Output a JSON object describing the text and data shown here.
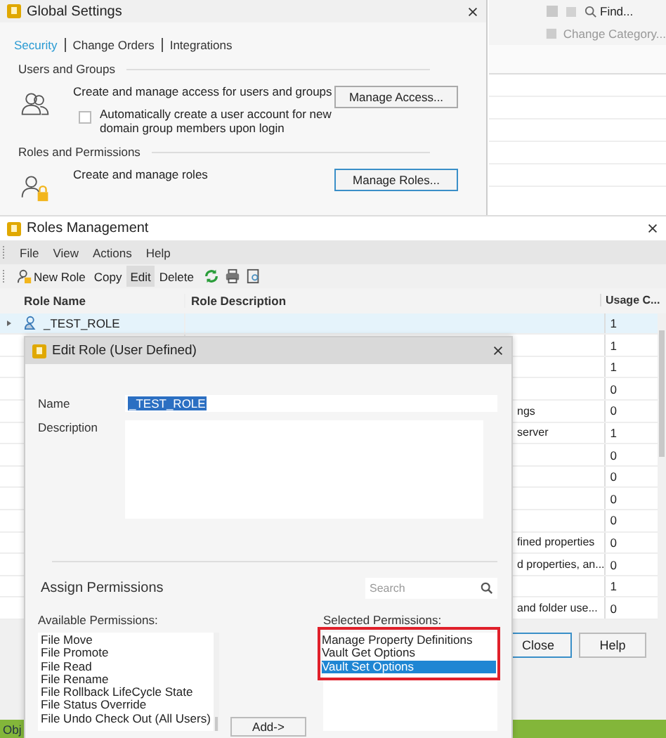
{
  "background_app": {
    "find_button": "Find...",
    "change_category_button": "Change Category..."
  },
  "global_settings": {
    "title": "Global Settings",
    "tabs": [
      {
        "label": "Security",
        "selected": true
      },
      {
        "label": "Change Orders",
        "selected": false
      },
      {
        "label": "Integrations",
        "selected": false
      }
    ],
    "sections": [
      {
        "kind": "users",
        "heading": "Users and Groups",
        "description": "Create and manage access for users and groups",
        "button": "Manage Access...",
        "checkbox": {
          "label": "Automatically create a user account for new domain group members upon login",
          "checked": false
        }
      },
      {
        "kind": "roles",
        "heading": "Roles and Permissions",
        "description": "Create and manage roles",
        "button": "Manage Roles..."
      }
    ]
  },
  "roles_management": {
    "title": "Roles Management",
    "menu": [
      "File",
      "View",
      "Actions",
      "Help"
    ],
    "toolbar": [
      {
        "kind": "new",
        "label": "New Role",
        "selected": false
      },
      {
        "kind": "text",
        "label": "Copy",
        "selected": false
      },
      {
        "kind": "text",
        "label": "Edit",
        "selected": true
      },
      {
        "kind": "text",
        "label": "Delete",
        "selected": false
      }
    ],
    "columns": [
      "Role Name",
      "Role Description",
      "Usage C..."
    ],
    "rows": [
      {
        "name": "_TEST_ROLE",
        "usage": "1",
        "selected": true
      },
      {
        "usage": "1",
        "selected": false
      },
      {
        "usage": "1",
        "selected": false
      },
      {
        "usage": "0",
        "selected": false
      },
      {
        "description": "ngs",
        "usage": "0",
        "selected": false
      },
      {
        "description": "server",
        "usage": "1",
        "selected": false
      },
      {
        "usage": "0",
        "selected": false
      },
      {
        "usage": "0",
        "selected": false
      },
      {
        "usage": "0",
        "selected": false
      },
      {
        "usage": "0",
        "selected": false
      },
      {
        "description": "fined properties",
        "usage": "0",
        "selected": false
      },
      {
        "description": "d properties, an...",
        "usage": "0",
        "selected": false
      },
      {
        "usage": "1",
        "selected": false
      },
      {
        "description": "and folder use...",
        "usage": "0",
        "selected": false
      }
    ],
    "buttons": [
      "Close",
      "Help"
    ],
    "status_bar": "Obj"
  },
  "edit_role": {
    "title": "Edit Role (User Defined)",
    "name_label": "Name",
    "name_value": "_TEST_ROLE",
    "name_highlighted": true,
    "description_label": "Description",
    "assign_heading": "Assign Permissions",
    "search": {
      "placeholder": "Search"
    },
    "available_label": "Available Permissions:",
    "available": [
      "File Move",
      "File Promote",
      "File Read",
      "File Rename",
      "File Rollback LifeCycle State",
      "File Status Override",
      "File Undo Check Out (All Users)"
    ],
    "add_button": "Add->",
    "selected_label": "Selected Permissions:",
    "selected_outlined": true,
    "selected": [
      {
        "label": "Manage Property Definitions",
        "selected": false
      },
      {
        "label": "Vault Get Options",
        "selected": false
      },
      {
        "label": "Vault Set Options",
        "selected": true
      }
    ]
  }
}
